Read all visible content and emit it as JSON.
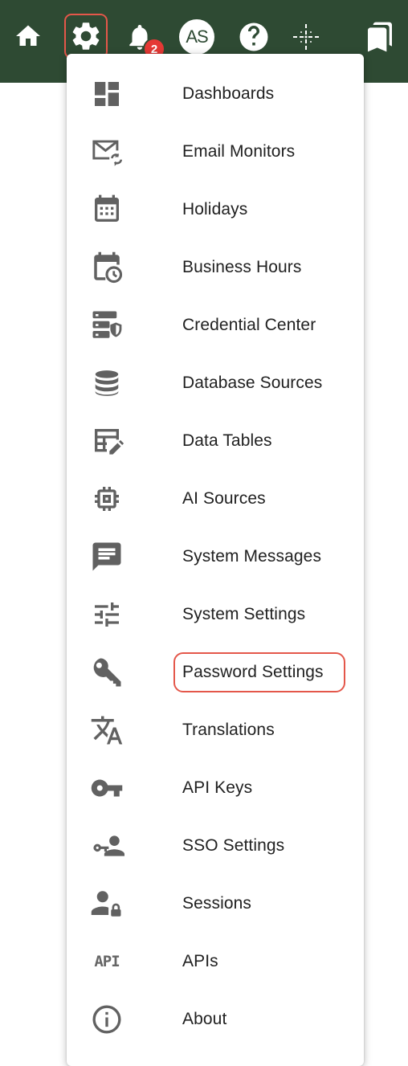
{
  "topbar": {
    "icons": [
      "home-icon",
      "settings-icon",
      "notifications-icon",
      "avatar",
      "help-icon",
      "sparkle-icon",
      "bookmarks-icon"
    ],
    "notification_count": "2",
    "avatar_initials": "AS",
    "bg_color": "#2e4a33",
    "highlight_color": "#e4574a"
  },
  "menu": {
    "items": [
      {
        "label": "Dashboards",
        "icon": "dashboard-icon"
      },
      {
        "label": "Email Monitors",
        "icon": "email-sync-icon"
      },
      {
        "label": "Holidays",
        "icon": "calendar-icon"
      },
      {
        "label": "Business Hours",
        "icon": "calendar-clock-icon"
      },
      {
        "label": "Credential Center",
        "icon": "server-shield-icon"
      },
      {
        "label": "Database Sources",
        "icon": "database-icon"
      },
      {
        "label": "Data Tables",
        "icon": "table-edit-icon"
      },
      {
        "label": "AI Sources",
        "icon": "chip-icon"
      },
      {
        "label": "System Messages",
        "icon": "message-icon"
      },
      {
        "label": "System Settings",
        "icon": "sliders-icon"
      },
      {
        "label": "Password Settings",
        "icon": "key-icon"
      },
      {
        "label": "Translations",
        "icon": "translate-icon"
      },
      {
        "label": "API Keys",
        "icon": "vpn-key-icon"
      },
      {
        "label": "SSO Settings",
        "icon": "key-person-icon"
      },
      {
        "label": "Sessions",
        "icon": "person-lock-icon"
      },
      {
        "label": "APIs",
        "icon": "api-icon",
        "icon_text": "API"
      },
      {
        "label": "About",
        "icon": "info-icon"
      }
    ],
    "highlighted_item": "Password Settings"
  }
}
